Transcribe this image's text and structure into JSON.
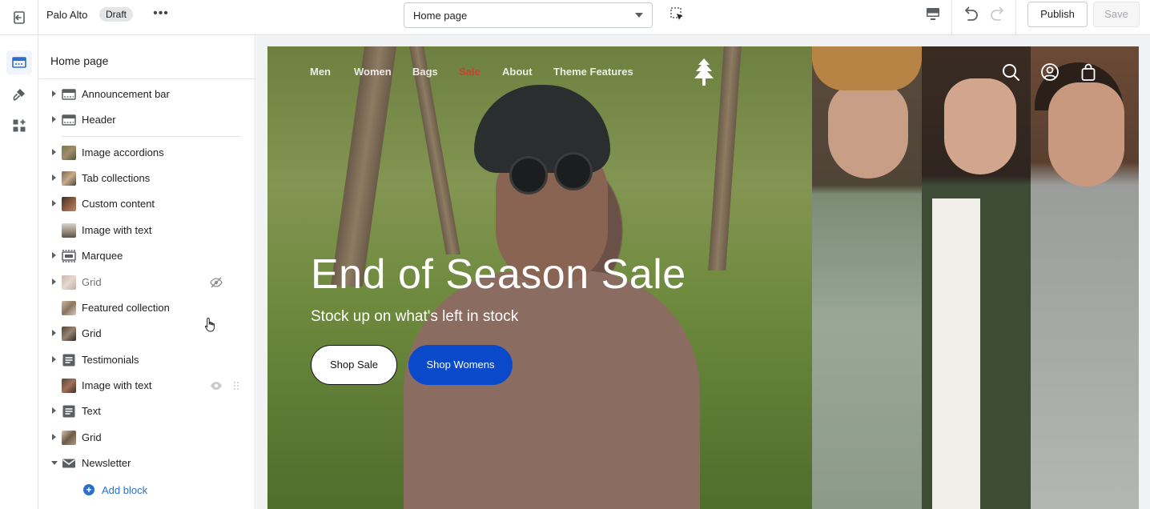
{
  "topbar": {
    "store_name": "Palo Alto",
    "status_badge": "Draft",
    "more": "•••",
    "page_select_value": "Home page",
    "publish_label": "Publish",
    "save_label": "Save"
  },
  "sidebar": {
    "title": "Home page",
    "items": [
      {
        "label": "Announcement bar",
        "icon": "section-icon",
        "expandable": true
      },
      {
        "label": "Header",
        "icon": "header-icon",
        "expandable": true
      },
      {
        "label": "Image accordions",
        "icon": "image-thumb",
        "expandable": true
      },
      {
        "label": "Tab collections",
        "icon": "image-thumb",
        "expandable": true
      },
      {
        "label": "Custom content",
        "icon": "image-thumb",
        "expandable": true
      },
      {
        "label": "Image with text",
        "icon": "image-thumb",
        "expandable": false
      },
      {
        "label": "Marquee",
        "icon": "marquee-icon",
        "expandable": true
      },
      {
        "label": "Grid",
        "icon": "image-thumb",
        "expandable": true,
        "hidden": true
      },
      {
        "label": "Featured collection",
        "icon": "image-thumb",
        "expandable": false
      },
      {
        "label": "Grid",
        "icon": "image-thumb",
        "expandable": true
      },
      {
        "label": "Testimonials",
        "icon": "text-icon",
        "expandable": true
      },
      {
        "label": "Image with text",
        "icon": "image-thumb",
        "expandable": false
      },
      {
        "label": "Text",
        "icon": "text-icon",
        "expandable": true
      },
      {
        "label": "Grid",
        "icon": "image-thumb",
        "expandable": true
      },
      {
        "label": "Newsletter",
        "icon": "mail-icon",
        "expandable": true,
        "expanded": true
      }
    ],
    "add_block": "Add block"
  },
  "preview": {
    "nav": [
      "Men",
      "Women",
      "Bags",
      "Sale",
      "About",
      "Theme Features"
    ],
    "hero_title": "End of Season Sale",
    "hero_subtitle": "Stock up on what's left in stock",
    "btn_primary": "Shop Sale",
    "btn_secondary": "Shop Womens"
  },
  "colors": {
    "accent": "#2c6ecb",
    "sale": "#c8432d",
    "button_blue": "#0a49c9",
    "rail_active": "#f2f4fd"
  }
}
